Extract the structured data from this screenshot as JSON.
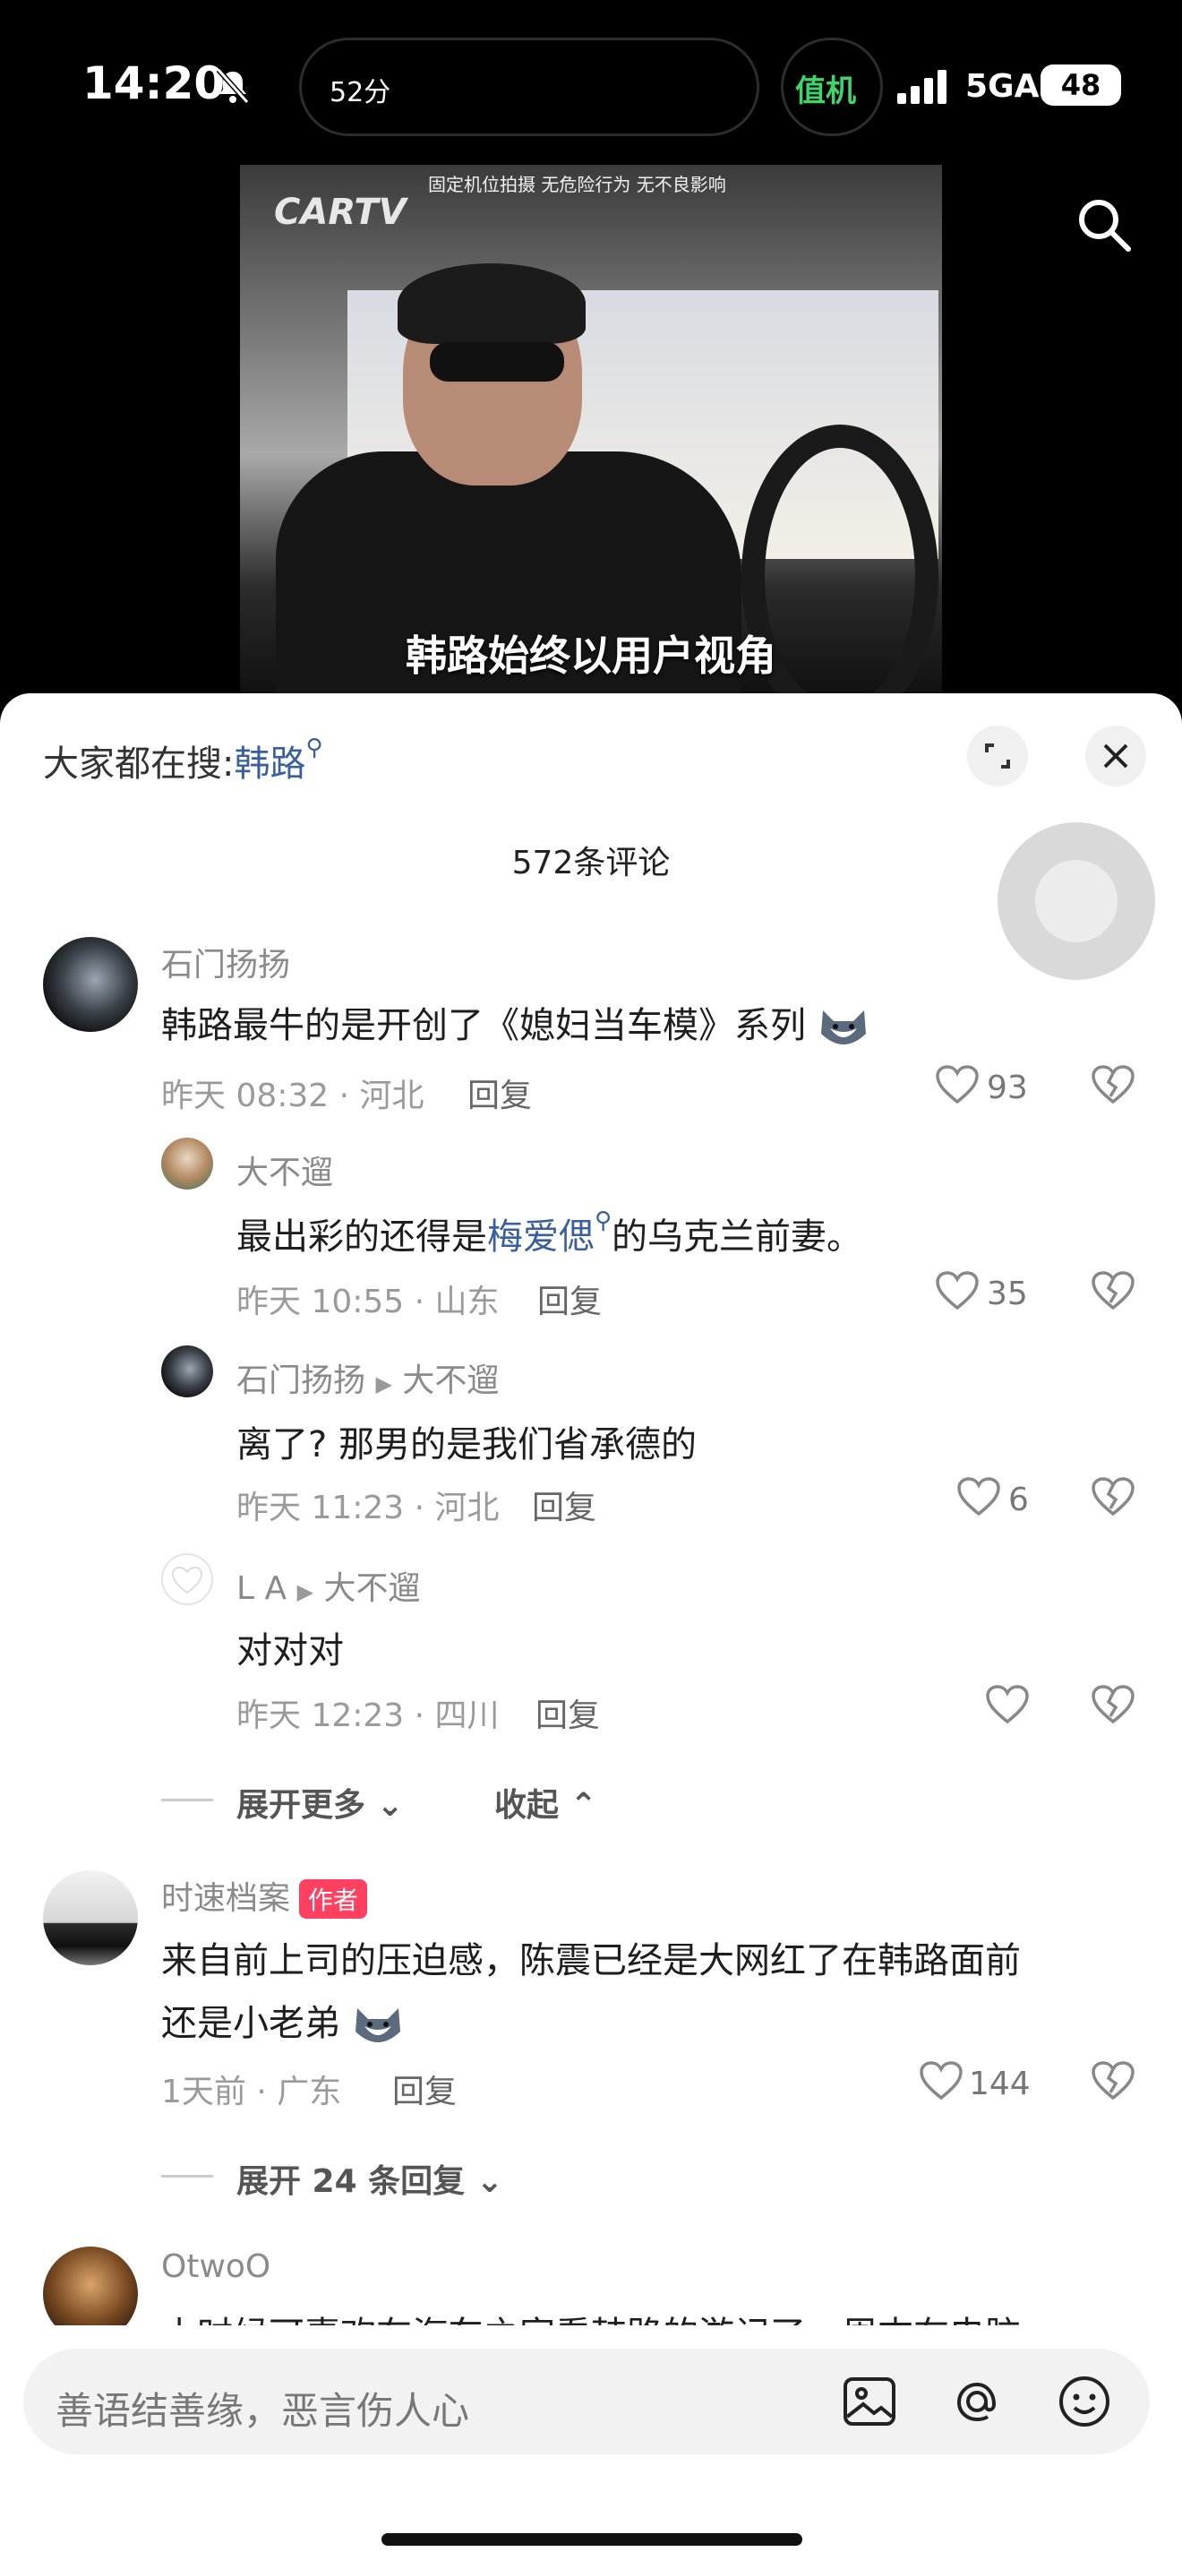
{
  "status_bar": {
    "time": "14:20",
    "island_text": "52分",
    "pill_text": "值机",
    "network": "5GA",
    "battery": "48"
  },
  "video": {
    "watermark": "CARTV",
    "top_note": "固定机位拍摄 无危险行为 无不良影响",
    "subtitle": "韩路始终以用户视角"
  },
  "panel": {
    "search_prefix": "大家都在搜:",
    "search_term": "韩路",
    "comment_count": "572条评论"
  },
  "comments": [
    {
      "name": "石门扬扬",
      "text": "韩路最牛的是开创了《媳妇当车模》系列",
      "time": "昨天 08:32",
      "location": "河北",
      "reply_label": "回复",
      "likes": "93"
    },
    {
      "name": "大不遛",
      "text_before": "最出彩的还得是",
      "text_link": "梅爱偲",
      "text_after": "的乌克兰前妻。",
      "time": "昨天 10:55",
      "location": "山东",
      "reply_label": "回复",
      "likes": "35"
    },
    {
      "name": "石门扬扬",
      "reply_to": "大不遛",
      "text": "离了? 那男的是我们省承德的",
      "time": "昨天 11:23",
      "location": "河北",
      "reply_label": "回复",
      "likes": "6"
    },
    {
      "name": "L A",
      "reply_to": "大不遛",
      "text": "对对对",
      "time": "昨天 12:23",
      "location": "四川",
      "reply_label": "回复",
      "likes": ""
    },
    {
      "name": "时速档案",
      "badge": "作者",
      "text_line1": "来自前上司的压迫感，陈震已经是大网红了在韩路面前",
      "text_line2": "还是小老弟",
      "time": "1天前",
      "location": "广东",
      "reply_label": "回复",
      "likes": "144"
    },
    {
      "name": "OtwoO",
      "text": "小时候可喜欢在汽车之家看韩路的游记了，周末在电脑"
    }
  ],
  "expand": {
    "more": "展开更多",
    "collapse": "收起",
    "expand_replies": "展开 24 条回复"
  },
  "input": {
    "placeholder": "善语结善缘，恶言伤人心"
  },
  "colors": {
    "link": "#3a5f9e",
    "author_badge": "#ff4060",
    "pill_green": "#3fd56b"
  }
}
